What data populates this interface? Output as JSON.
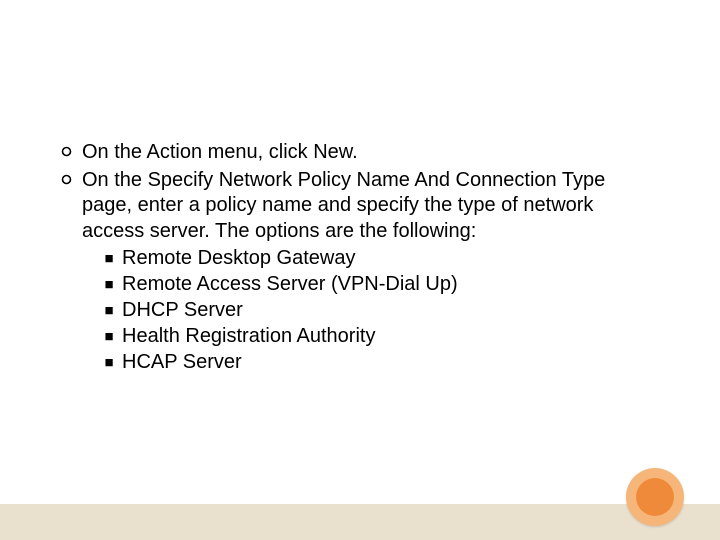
{
  "bullets": [
    {
      "text": "On the Action menu, click New."
    },
    {
      "text": "On the Specify Network Policy Name And Connection Type page, enter a policy name and specify the type of network access server. The options are the following:",
      "sub": [
        "Remote Desktop Gateway",
        "Remote Access Server (VPN-Dial Up)",
        "DHCP Server",
        "Health Registration Authority",
        "HCAP Server"
      ]
    }
  ]
}
